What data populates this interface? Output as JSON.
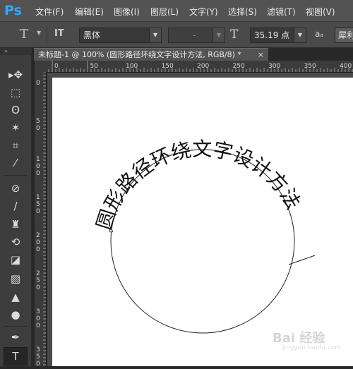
{
  "app": {
    "logo": "Ps",
    "menu": [
      "文件(F)",
      "编辑(E)",
      "图像(I)",
      "图层(L)",
      "文字(Y)",
      "选择(S)",
      "滤镜(T)",
      "视图(V)"
    ]
  },
  "options_bar": {
    "tool_icon": "T",
    "orientation_icon": "IT",
    "font_family": "黑体",
    "font_style": "-",
    "size_icon": "T",
    "font_size": "35.19 点",
    "aa_icon": "aₐ",
    "antialias": "犀利"
  },
  "document": {
    "tab_title": "未标题-1 @ 100% (圆形路径环绕文字设计方法, RGB/8) *",
    "close": "×"
  },
  "rulers": {
    "horizontal": [
      "0",
      "50",
      "100",
      "150",
      "200",
      "250",
      "300",
      "350",
      "400"
    ],
    "vertical": [
      "0",
      "5\n0",
      "1\n0\n0",
      "1\n5\n0",
      "2\n0\n0",
      "2\n5\n0",
      "3\n0\n0",
      "3\n5\n0"
    ]
  },
  "canvas": {
    "path_text": "圆形路径环绕文字设计方法"
  },
  "watermark": {
    "text": "Bai 经验",
    "sub": "jingyan.baidu.com"
  },
  "colors": {
    "accent": "#31a8ff",
    "ui_dark": "#282828",
    "ui_panel": "#535353"
  }
}
